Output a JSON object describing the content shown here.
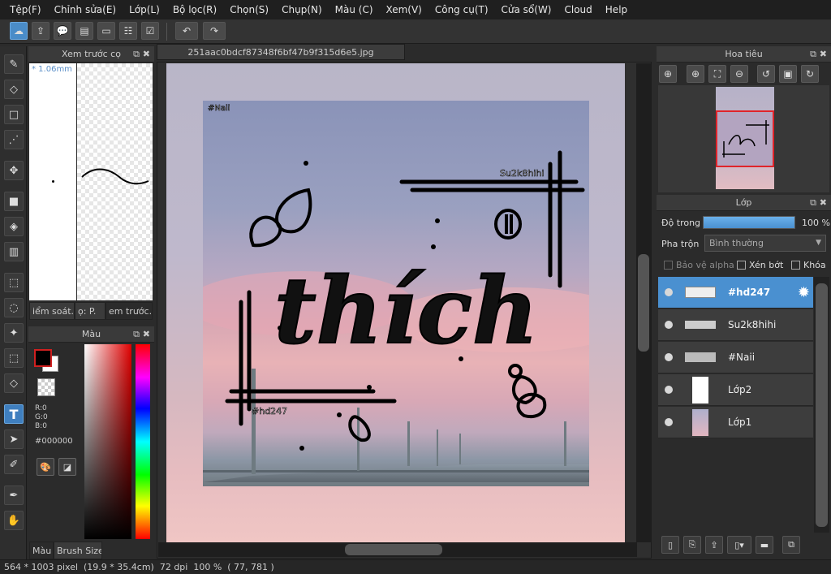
{
  "menu": [
    "Tệp(F)",
    "Chỉnh sửa(E)",
    "Lớp(L)",
    "Bộ lọc(R)",
    "Chọn(S)",
    "Chụp(N)",
    "Màu (C)",
    "Xem(V)",
    "Công cụ(T)",
    "Cửa sổ(W)",
    "Cloud",
    "Help"
  ],
  "brush_preview": {
    "title": "Xem trước cọ",
    "size_label": "* 1.06mm",
    "tabs": [
      "iểm soát.",
      "ọ: P.",
      "em trước."
    ]
  },
  "color_panel": {
    "title": "Màu",
    "r": "R:0",
    "g": "G:0",
    "b": "B:0",
    "hex": "#000000",
    "tabs": [
      "Màu",
      "Brush Size"
    ],
    "foreground": "#000000",
    "background": "#ffffff"
  },
  "document": {
    "tab_title": "251aac0bdcf87348f6bf47b9f315d6e5.jpg"
  },
  "artwork": {
    "watermark_tl": "#Naii",
    "watermark_tr": "Su2k8hihi",
    "watermark_bl": "#hd247",
    "main_text": "thích"
  },
  "navigator": {
    "title": "Hoa tiêu"
  },
  "layers_panel": {
    "title": "Lớp",
    "opacity_label": "Độ trong",
    "opacity_value": "100 %",
    "opacity_level": 1.0,
    "blend_label": "Pha trộn",
    "blend_value": "Bình thường",
    "protect_alpha": "Bảo vệ alpha",
    "clipping": "Xén bớt",
    "lock": "Khóa",
    "layers": [
      {
        "name": "#hd247",
        "selected": true
      },
      {
        "name": "Su2k8hihi",
        "selected": false
      },
      {
        "name": "#Naii",
        "selected": false
      },
      {
        "name": "Lớp2",
        "selected": false
      },
      {
        "name": "Lớp1",
        "selected": false
      }
    ]
  },
  "status": {
    "text": "564 * 1003 pixel  (19.9 * 35.4cm)  72 dpi  100 %  ( 77, 781 )"
  },
  "colors": {
    "accent": "#4a90d0",
    "nav_frame": "#e0242a"
  }
}
